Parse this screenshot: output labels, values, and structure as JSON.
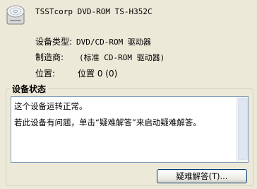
{
  "device": {
    "name": "TSSTcorp DVD-ROM TS-H352C",
    "icon": "cd-drive-icon"
  },
  "properties": {
    "type_label": "设备类型:",
    "type_value": "DVD/CD-ROM 驱动器",
    "manufacturer_label": "制造商:",
    "manufacturer_value": "(标准 CD-ROM 驱动器)",
    "location_label": "位置:",
    "location_value": "位置 0 (0)"
  },
  "status_group": {
    "title": "设备状态",
    "line1": "这个设备运转正常。",
    "line2": "若此设备有问题，单击“疑难解答”来启动疑难解答。"
  },
  "buttons": {
    "troubleshoot_label": "疑难解答(T)..."
  }
}
